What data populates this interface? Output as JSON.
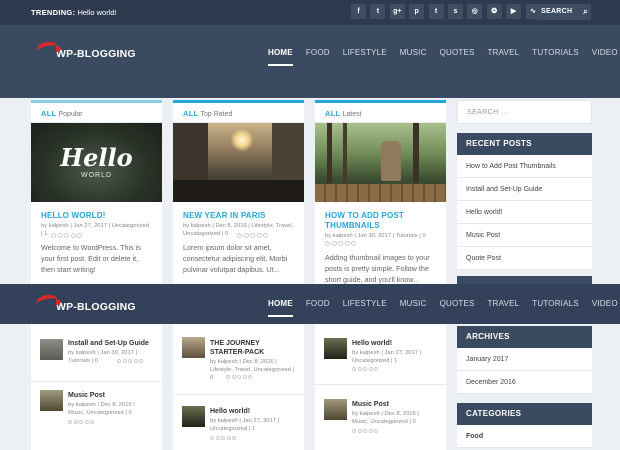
{
  "topbar": {
    "trending_label": "TRENDING:",
    "trending_text": "Hello world!",
    "social_icons": [
      "facebook-icon",
      "twitter-icon",
      "google-plus-icon",
      "pinterest-icon",
      "tumblr-icon",
      "stumbleupon-icon",
      "instagram-icon",
      "dribbble-icon",
      "youtube-icon",
      "rss-icon"
    ],
    "social_glyphs": [
      "f",
      "t",
      "g+",
      "p",
      "t",
      "s",
      "◎",
      "❂",
      "▶",
      "∿"
    ],
    "search_label": "SEARCH",
    "search_glyph": "⌕"
  },
  "logo": {
    "text": "WP-BLOGGING"
  },
  "nav": {
    "items": [
      "HOME",
      "FOOD",
      "LIFESTYLE",
      "MUSIC",
      "QUOTES",
      "TRAVEL",
      "TUTORIALS",
      "VIDEO"
    ],
    "active": "HOME"
  },
  "cards": [
    {
      "tab_prefix": "ALL",
      "tab_label": "Popular",
      "title": "HELLO WORLD!",
      "image_text_1": "Hello",
      "image_text_2": "WORLD",
      "meta_line1": "by kalpesh | Jan 27, 2017 | Uncategorized",
      "meta_line2": "| 1",
      "excerpt": "Welcome to WordPress. This is your first post. Edit or delete it, then start writing!"
    },
    {
      "tab_prefix": "ALL",
      "tab_label": "Top Rated",
      "title": "NEW YEAR IN PARIS",
      "meta_line1": "by kalpesh | Dec 8, 2016 | Lifestyle, Travel,",
      "meta_line2": "Uncategorized | 0",
      "excerpt": "Lorem ipsum dolor sit amet, consectetur adipiscing elit. Morbi pulvinar volutpat dapibus. Ut..."
    },
    {
      "tab_prefix": "ALL",
      "tab_label": "Latest",
      "title": "HOW TO ADD POST THUMBNAILS",
      "meta_line1": "by kalpesh | Jan 30, 2017 | Tutorials | 0",
      "meta_line2": "",
      "excerpt": "Adding thumbnail images to your posts is pretty simple. Follow the short guide, and you'll know..."
    }
  ],
  "sidebar": {
    "search_placeholder": "SEARCH ...",
    "recent_posts_title": "RECENT POSTS",
    "recent_posts": [
      "How to Add Post Thumbnails",
      "Install and Set-Up Guide",
      "Hello world!",
      "Music Post",
      "Quote Post"
    ],
    "archives_title": "ARCHIVES",
    "archives": [
      "January 2017",
      "December 2016"
    ],
    "categories_title": "CATEGORIES",
    "categories": [
      "Food"
    ]
  },
  "lists": {
    "col1": [
      {
        "title": "Install and Set-Up Guide",
        "meta1": "by kalpesh | Jan 30, 2017 |",
        "meta2": "Tutorials | 0"
      },
      {
        "title": "Music Post",
        "meta1": "by kalpesh | Dec 8, 2016 |",
        "meta2": "Music, Uncategorized | 0"
      }
    ],
    "col2": [
      {
        "title": "THE JOURNEY STARTER-PACK",
        "meta1": "by kalpesh | Dec 8, 2016 |",
        "meta2": "Lifestyle, Travel, Uncategorized |",
        "meta3": "0"
      },
      {
        "title": "Hello world!",
        "meta1": "by kalpesh | Jan 27, 2017 |",
        "meta2": "Uncategorized | 1"
      }
    ],
    "col3": [
      {
        "title": "Hello world!",
        "meta1": "by kalpesh | Jan 27, 2017 |",
        "meta2": "Uncategorized | 1"
      },
      {
        "title": "Music Post",
        "meta1": "by kalpesh | Dec 8, 2016 |",
        "meta2": "Music, Uncategorized | 0"
      }
    ]
  },
  "colors": {
    "accent": "#22a7d8",
    "header": "#3a4a60",
    "topbar": "#2e3b4e"
  }
}
